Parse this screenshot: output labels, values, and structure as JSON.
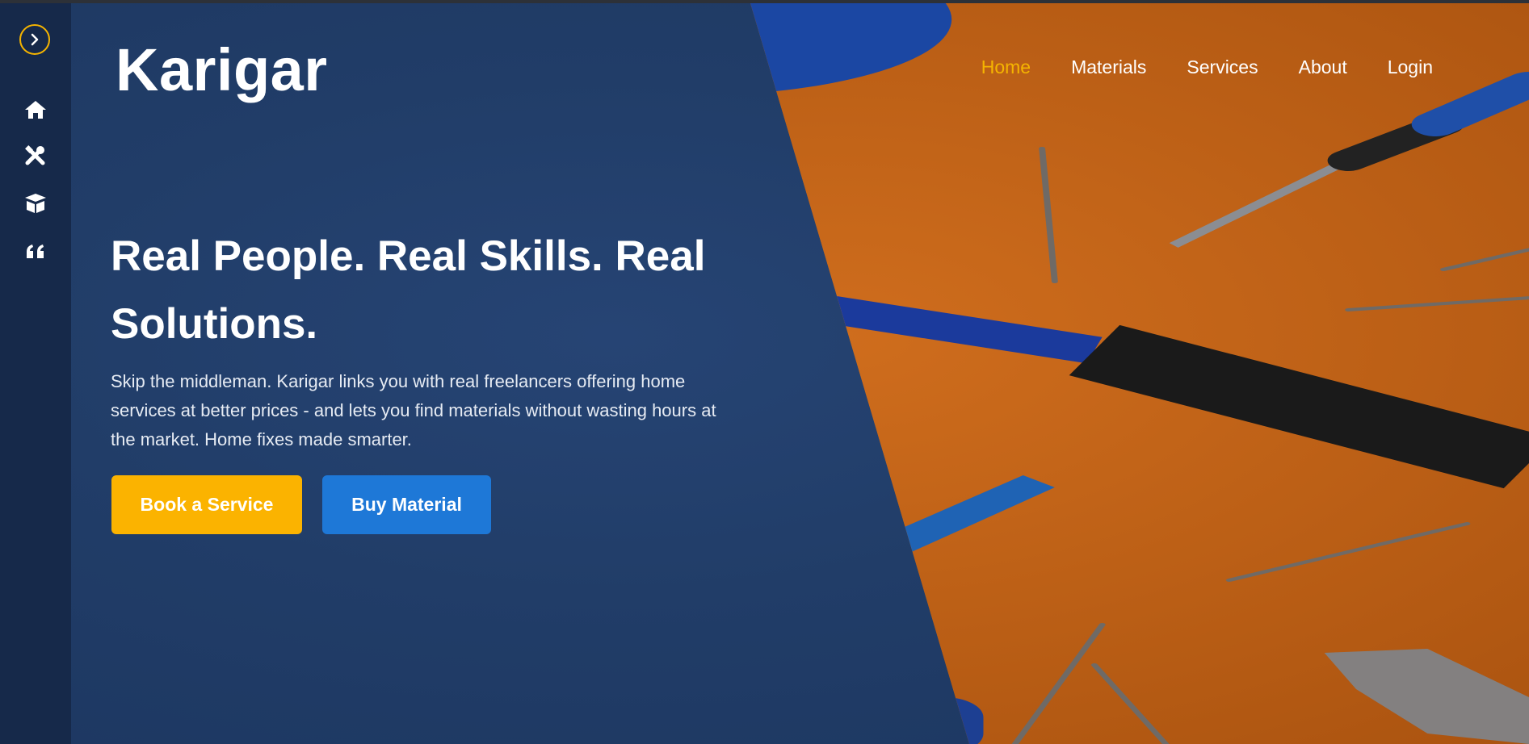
{
  "app": {
    "brand": "Karigar"
  },
  "rail": {
    "items": [
      {
        "icon": "home-icon"
      },
      {
        "icon": "tools-icon"
      },
      {
        "icon": "box-icon"
      },
      {
        "icon": "quote-icon"
      }
    ],
    "toggle_icon": "chevron-right-icon"
  },
  "nav": {
    "items": [
      {
        "label": "Home",
        "active": true
      },
      {
        "label": "Materials"
      },
      {
        "label": "Services"
      },
      {
        "label": "About"
      },
      {
        "label": "Login"
      }
    ]
  },
  "hero": {
    "headline": "Real People. Real Skills. Real Solutions.",
    "subtext": "Skip the middleman. Karigar links you with real freelancers offering home services at better prices - and lets you find materials without wasting hours at the market. Home fixes made smarter.",
    "primary_button": "Book a Service",
    "secondary_button": "Buy Material"
  },
  "colors": {
    "accent": "#f5b400",
    "primary_button": "#fbb300",
    "secondary_button": "#1e78d7",
    "background": "#213d68",
    "photo_orange": "#c9661a"
  }
}
